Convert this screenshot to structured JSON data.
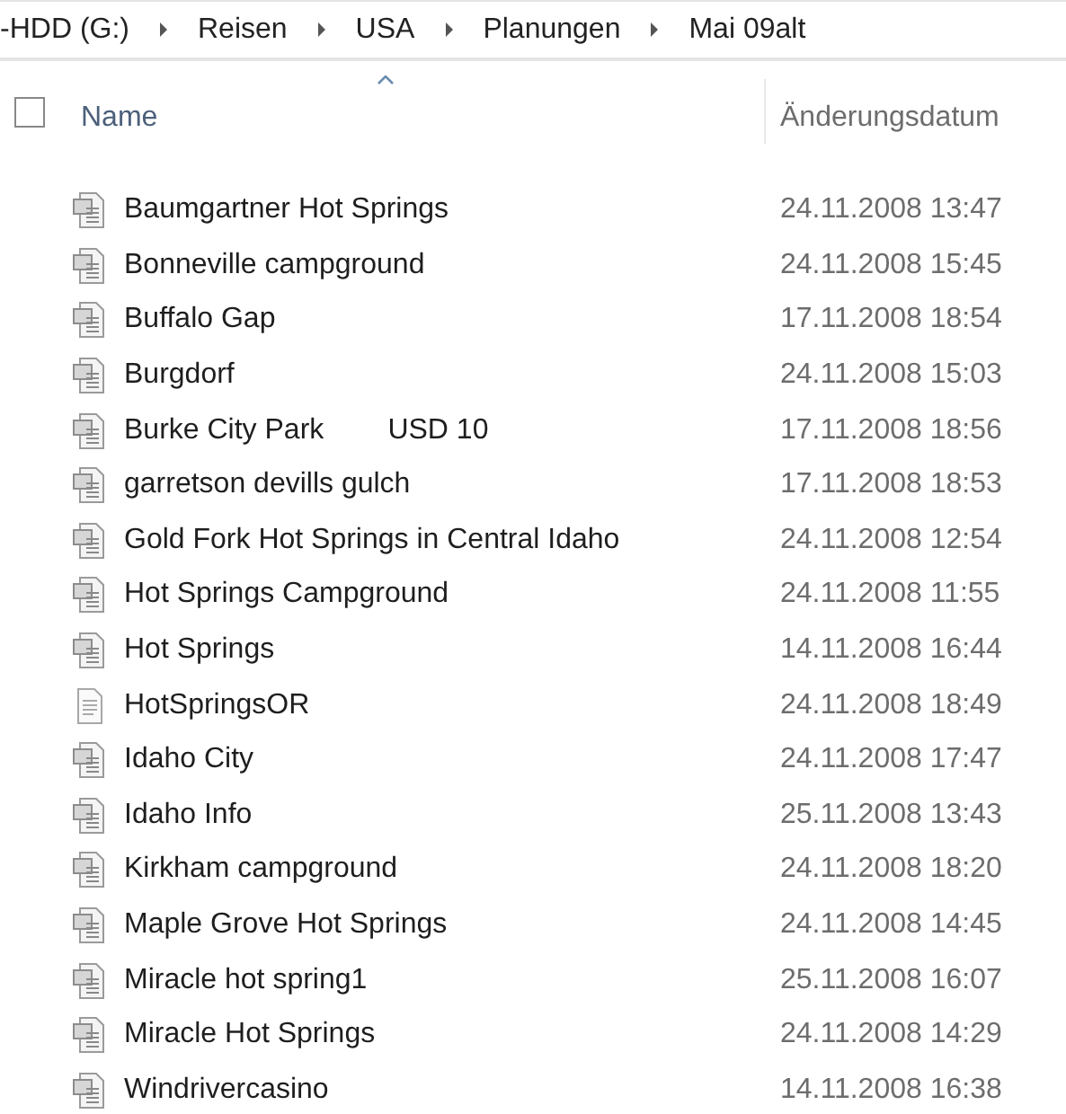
{
  "breadcrumb": [
    "-HDD (G:)",
    "Reisen",
    "USA",
    "Planungen",
    "Mai 09alt"
  ],
  "table": {
    "select_all": {
      "checked": false
    },
    "columns": [
      {
        "label": "Name",
        "sorted": true
      },
      {
        "label": "Änderungsdatum",
        "sorted": false
      }
    ],
    "rows": [
      {
        "name": "Baumgartner Hot Springs",
        "date": "24.11.2008 13:47",
        "kind": "doc"
      },
      {
        "name": "Bonneville campground",
        "date": "24.11.2008 15:45",
        "kind": "doc"
      },
      {
        "name": "Buffalo Gap",
        "date": "17.11.2008 18:54",
        "kind": "doc"
      },
      {
        "name": "Burgdorf",
        "date": "24.11.2008 15:03",
        "kind": "doc"
      },
      {
        "name": "Burke City Park        USD 10",
        "date": "17.11.2008 18:56",
        "kind": "doc"
      },
      {
        "name": "garretson devills gulch",
        "date": "17.11.2008 18:53",
        "kind": "doc"
      },
      {
        "name": "Gold Fork Hot Springs in Central Idaho",
        "date": "24.11.2008 12:54",
        "kind": "doc"
      },
      {
        "name": "Hot Springs Campground",
        "date": "24.11.2008 11:55",
        "kind": "doc"
      },
      {
        "name": "Hot Springs",
        "date": "14.11.2008 16:44",
        "kind": "doc"
      },
      {
        "name": "HotSpringsOR",
        "date": "24.11.2008 18:49",
        "kind": "text"
      },
      {
        "name": "Idaho City",
        "date": "24.11.2008 17:47",
        "kind": "doc"
      },
      {
        "name": "Idaho Info",
        "date": "25.11.2008 13:43",
        "kind": "doc"
      },
      {
        "name": "Kirkham campground",
        "date": "24.11.2008 18:20",
        "kind": "doc"
      },
      {
        "name": "Maple Grove Hot Springs",
        "date": "24.11.2008 14:45",
        "kind": "doc"
      },
      {
        "name": "Miracle hot spring1",
        "date": "25.11.2008 16:07",
        "kind": "doc"
      },
      {
        "name": "Miracle Hot Springs",
        "date": "24.11.2008 14:29",
        "kind": "doc"
      },
      {
        "name": "Windrivercasino",
        "date": "14.11.2008 16:38",
        "kind": "doc"
      }
    ]
  }
}
